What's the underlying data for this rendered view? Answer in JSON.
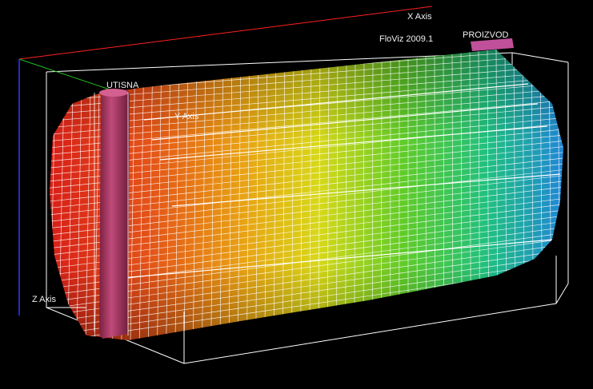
{
  "viewer": {
    "product_label": "FloViz 2009.1",
    "background_color": "#000000",
    "box_edge_color": "#ffffff",
    "mesh_line_color": "#ffffff"
  },
  "axes": {
    "x_label": "X Axis",
    "y_label": "Y Axis",
    "z_label": "Z Axis",
    "x_color": "#ff2020",
    "y_color": "#20c020",
    "z_color": "#2040ff"
  },
  "ports": {
    "inlet_label": "UTISNA",
    "outlet_label": "PROIZVOD",
    "inlet_color": "#b03a6e",
    "outlet_color": "#c0509a"
  },
  "field": {
    "colormap": [
      "#e0201a",
      "#e86a10",
      "#e8c010",
      "#a0d020",
      "#20c030",
      "#20b8c0",
      "#2080e0"
    ]
  }
}
